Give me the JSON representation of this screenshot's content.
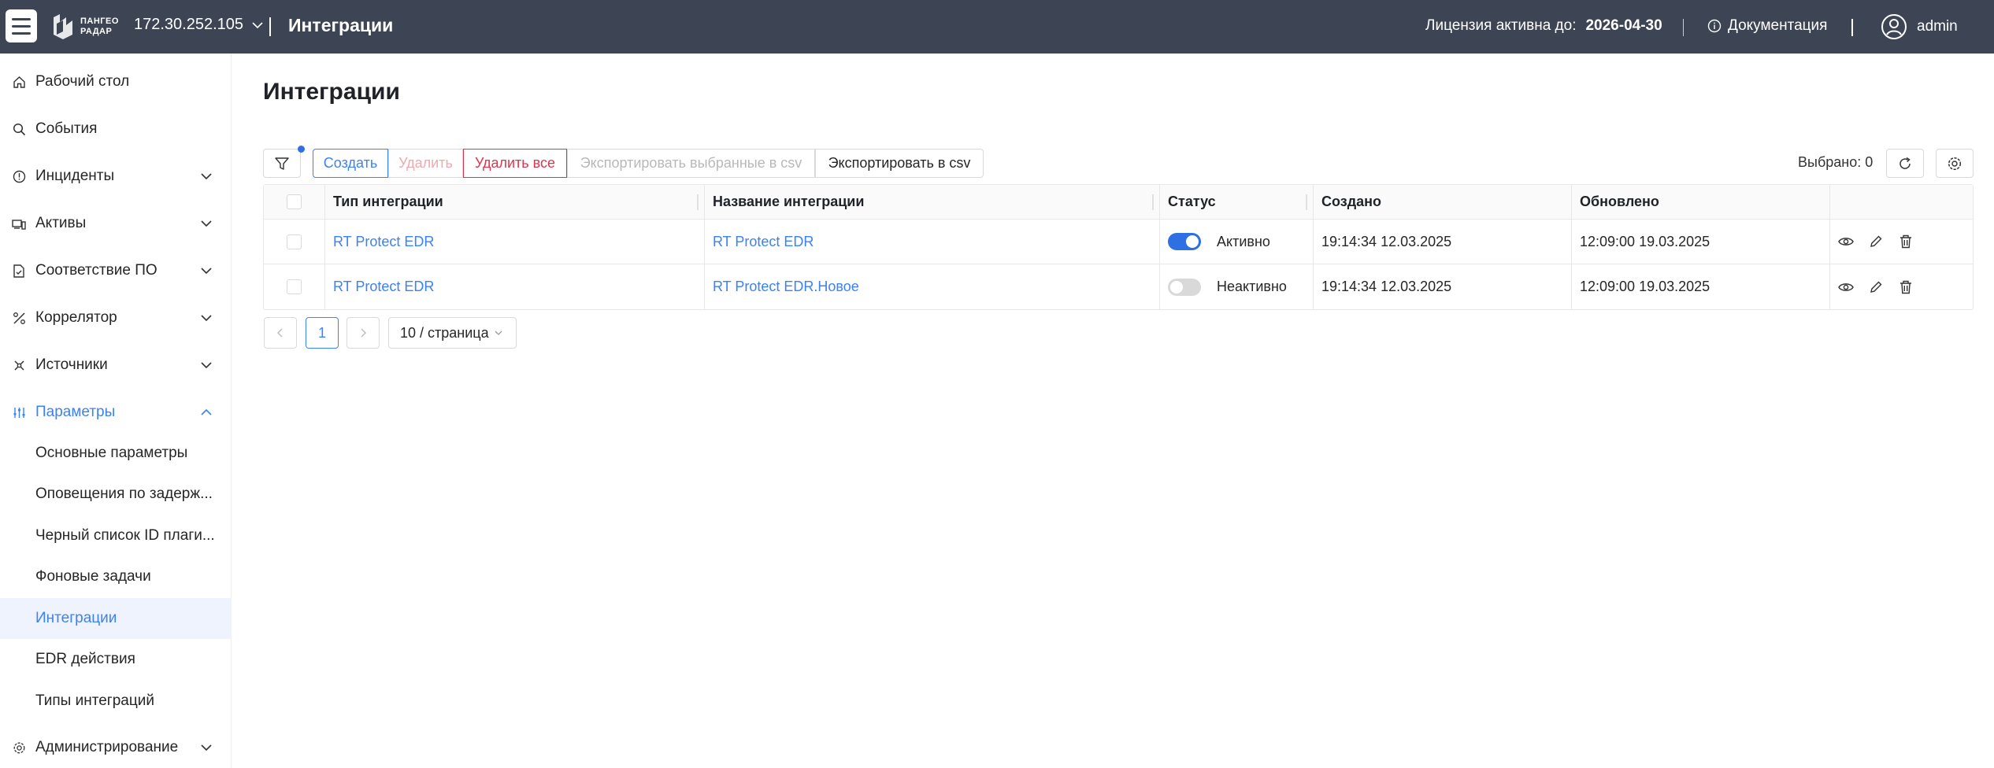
{
  "header": {
    "logo_line1": "ПАНГЕО",
    "logo_line2": "РАДАР",
    "host": "172.30.252.105",
    "title": "Интеграции",
    "license_label": "Лицензия активна до:",
    "license_date": "2026-04-30",
    "docs_label": "Документация",
    "user": "admin"
  },
  "sidebar": {
    "items": [
      {
        "label": "Рабочий стол",
        "icon": "home-icon"
      },
      {
        "label": "События",
        "icon": "search-icon"
      },
      {
        "label": "Инциденты",
        "icon": "info-circle-icon"
      },
      {
        "label": "Активы",
        "icon": "devices-icon"
      },
      {
        "label": "Соответствие ПО",
        "icon": "file-check-icon"
      },
      {
        "label": "Коррелятор",
        "icon": "correlator-icon"
      },
      {
        "label": "Источники",
        "icon": "sources-icon"
      },
      {
        "label": "Параметры",
        "icon": "sliders-icon"
      }
    ],
    "subitems": [
      {
        "label": "Основные параметры"
      },
      {
        "label": "Оповещения по задерж..."
      },
      {
        "label": "Черный список ID плаги..."
      },
      {
        "label": "Фоновые задачи"
      },
      {
        "label": "Интеграции"
      },
      {
        "label": "EDR действия"
      },
      {
        "label": "Типы интеграций"
      }
    ],
    "admin": {
      "label": "Администрирование",
      "icon": "gear-icon"
    }
  },
  "main": {
    "title": "Интеграции",
    "toolbar": {
      "create": "Создать",
      "delete": "Удалить",
      "delete_all": "Удалить все",
      "export_selected": "Экспортировать выбранные в csv",
      "export": "Экспортировать в csv",
      "selected": "Выбрано: 0"
    },
    "table": {
      "columns": [
        "Тип интеграции",
        "Название интеграции",
        "Статус",
        "Создано",
        "Обновлено"
      ],
      "rows": [
        {
          "type": "RT Protect EDR",
          "name": "RT Protect EDR",
          "status": "Активно",
          "active": true,
          "created": "19:14:34 12.03.2025",
          "updated": "12:09:00 19.03.2025"
        },
        {
          "type": "RT Protect EDR",
          "name": "RT Protect EDR.Новое",
          "status": "Неактивно",
          "active": false,
          "created": "19:14:34 12.03.2025",
          "updated": "12:09:00 19.03.2025"
        }
      ]
    },
    "pagination": {
      "current": "1",
      "page_size": "10 / страница"
    }
  },
  "colors": {
    "header_bg": "#3d4554",
    "accent": "#3b82f6",
    "danger": "#d9364c"
  }
}
